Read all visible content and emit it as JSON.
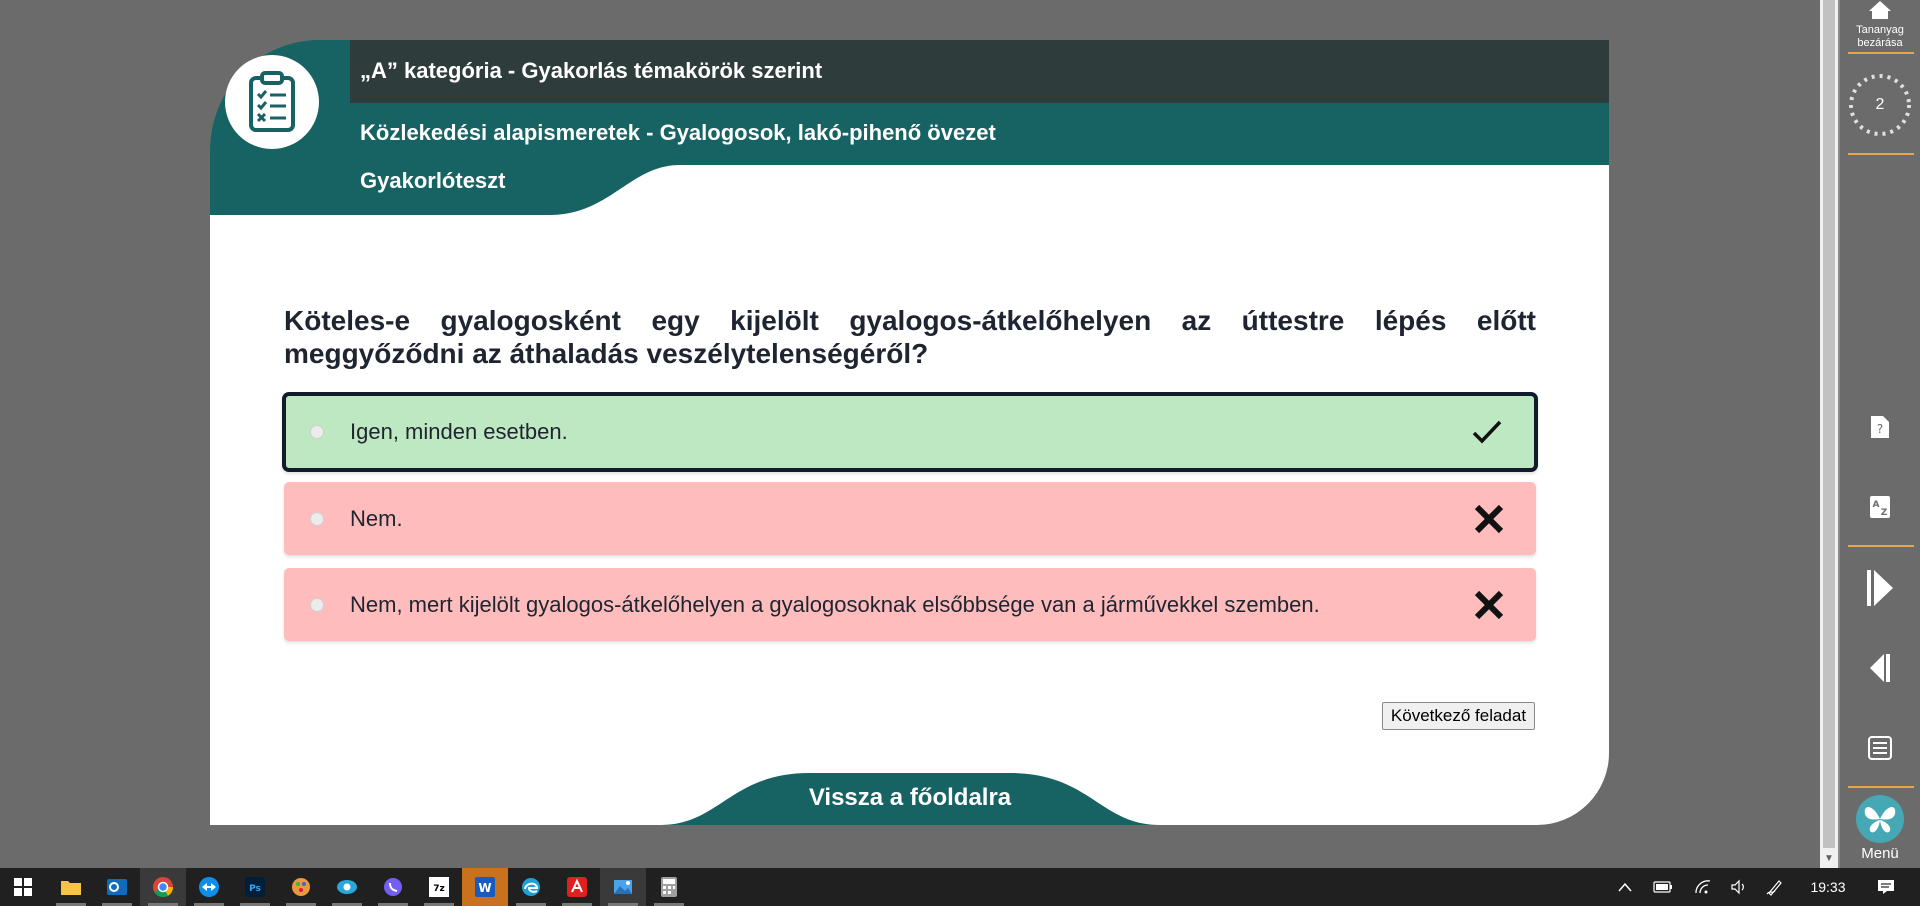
{
  "header": {
    "category": "„A” kategória - Gyakorlás témakörök szerint",
    "topic": "Közlekedési alapismeretek - Gyalogosok, lakó-pihenő övezet",
    "test_type": "Gyakorlóteszt",
    "icon": "clipboard-checklist-icon"
  },
  "question": {
    "text": "Köteles-e gyalogosként egy kijelölt gyalogos-átkelőhelyen az úttestre lépés előtt meggyőződni az áthaladás veszélytelenségéről?"
  },
  "answers": [
    {
      "text": "Igen, minden esetben.",
      "status": "correct",
      "selected": true,
      "icon": "checkmark-icon"
    },
    {
      "text": "Nem.",
      "status": "wrong",
      "selected": false,
      "icon": "cross-icon"
    },
    {
      "text": "Nem, mert kijelölt gyalogos-átkelőhelyen a gyalogosoknak elsőbbsége van a járművekkel szemben.",
      "status": "wrong",
      "selected": false,
      "icon": "cross-icon"
    }
  ],
  "next_button": {
    "label": "Következő feladat"
  },
  "back_home": {
    "label": "Vissza a főoldalra"
  },
  "right_panel": {
    "close_label": "Tananyag bezárása",
    "counter": "2",
    "menu_label": "Menü",
    "items": [
      "home-icon",
      "timer-ring-icon",
      "help-document-icon",
      "dictionary-icon",
      "next-page-icon",
      "previous-page-icon",
      "list-icon",
      "butterfly-logo-icon"
    ]
  },
  "taskbar": {
    "apps": [
      "windows-start-icon",
      "file-explorer-icon",
      "outlook-icon",
      "chrome-icon",
      "teamviewer-icon",
      "photoshop-icon",
      "paint-palette-icon",
      "eye-app-icon",
      "viber-icon",
      "7zip-icon",
      "word-icon",
      "edge-icon",
      "acrobat-icon",
      "paint-icon",
      "calculator-icon"
    ],
    "clock": "19:33"
  },
  "colors": {
    "teal": "#176263",
    "dark_band": "#2f3c3c",
    "correct_bg": "#bde8c1",
    "wrong_bg": "#ffbcbc",
    "accent_orange": "#e8a64a"
  }
}
